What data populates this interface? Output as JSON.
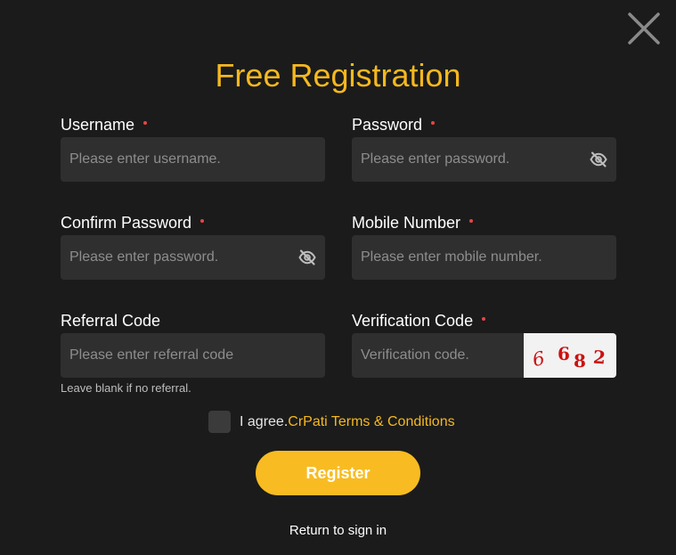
{
  "title": "Free Registration",
  "fields": {
    "username": {
      "label": "Username",
      "placeholder": "Please enter username.",
      "value": ""
    },
    "password": {
      "label": "Password",
      "placeholder": "Please enter password.",
      "value": ""
    },
    "confirm_password": {
      "label": "Confirm Password",
      "placeholder": "Please enter password.",
      "value": ""
    },
    "mobile": {
      "label": "Mobile Number",
      "placeholder": "Please enter mobile number.",
      "value": ""
    },
    "referral": {
      "label": "Referral Code",
      "placeholder": "Please enter referral code",
      "value": "",
      "hint": "Leave blank if no referral."
    },
    "verification": {
      "label": "Verification Code",
      "placeholder": "Verification code.",
      "value": ""
    }
  },
  "captcha": {
    "chars": [
      "6",
      "6",
      "8",
      "2"
    ]
  },
  "agreement": {
    "prefix": "I agree.",
    "link": "CrPati Terms & Conditions",
    "checked": false
  },
  "register_button": "Register",
  "return_link": "Return to sign in",
  "icons": {
    "close": "close-icon",
    "password_toggle": "eye-slash-icon"
  },
  "colors": {
    "background": "#1b1b1b",
    "accent": "#f5b81f",
    "button": "#f8bc22",
    "input_bg": "#2f2f2f",
    "required_dot": "#e64545",
    "captcha_text": "#cc1111"
  }
}
